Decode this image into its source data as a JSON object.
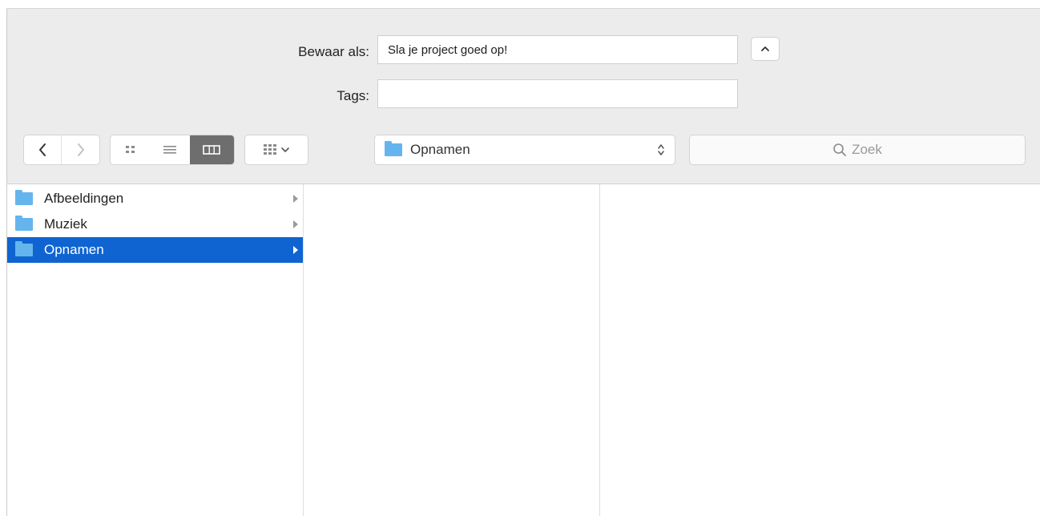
{
  "save_panel": {
    "save_as_label": "Bewaar als:",
    "save_as_value": "Sla je project goed op!",
    "tags_label": "Tags:",
    "tags_value": ""
  },
  "toolbar": {
    "back_icon": "chevron-left-icon",
    "forward_icon": "chevron-right-icon",
    "view_modes": [
      "icon-view",
      "list-view",
      "column-view"
    ],
    "active_view": "column-view",
    "group_menu_icon": "grid-icon",
    "location": "Opnamen",
    "search_placeholder": "Zoek"
  },
  "browser": {
    "column1": [
      {
        "label": "Afbeeldingen",
        "selected": false
      },
      {
        "label": "Muziek",
        "selected": false
      },
      {
        "label": "Opnamen",
        "selected": true
      }
    ]
  },
  "colors": {
    "selection": "#0f64d2",
    "folder": "#64b5ee",
    "header_bg": "#ececec"
  }
}
